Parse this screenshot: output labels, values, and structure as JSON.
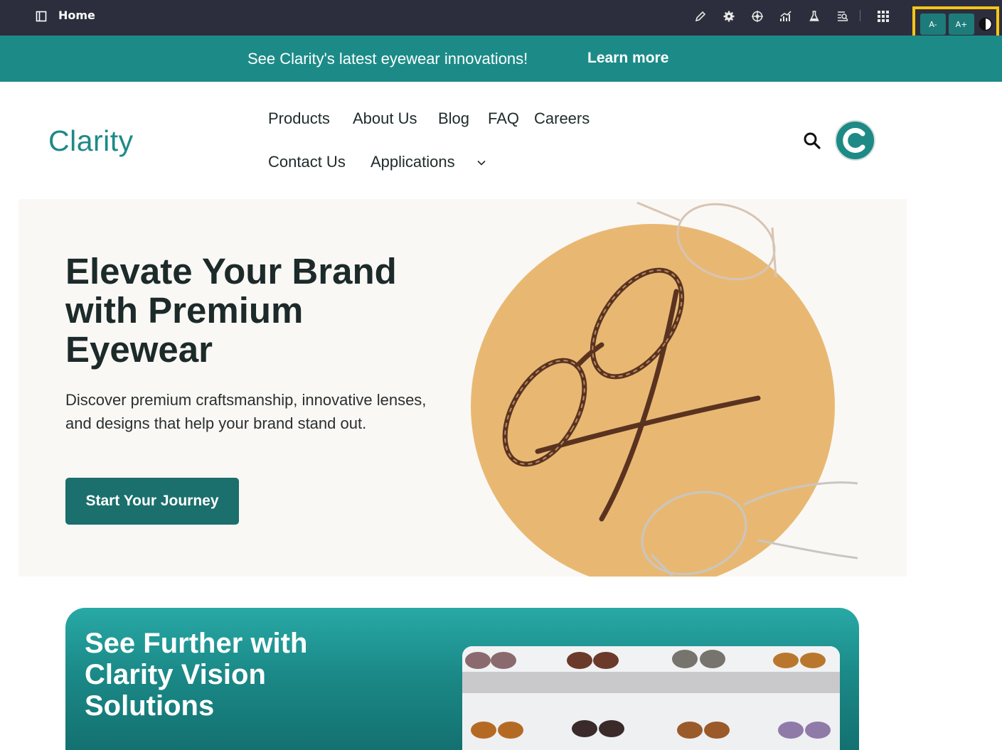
{
  "topbar": {
    "title": "Home",
    "tools": [
      "pencil-icon",
      "gear-icon",
      "target-icon",
      "chart-icon",
      "flask-icon",
      "inspect-icon"
    ],
    "apps_icon": "grid-icon"
  },
  "accessibility": {
    "decrease_label": "A-",
    "increase_label": "A+",
    "contrast_icon": "contrast-icon",
    "accent_color": "#1d7b7a",
    "highlight_color": "#f5c518"
  },
  "announcement": {
    "message": "See Clarity's latest eyewear innovations!",
    "link_label": "Learn more",
    "background": "#1c8b88"
  },
  "header": {
    "logo": "Clarity",
    "nav": {
      "row1": [
        "Products",
        "About Us",
        "Blog",
        "FAQ",
        "Careers"
      ],
      "row2": [
        "Contact Us",
        "Applications"
      ]
    },
    "avatar_initial": "C"
  },
  "hero": {
    "title": "Elevate Your Brand with Premium Eyewear",
    "description": "Discover premium craftsmanship, innovative lenses, and designs that help your brand stand out.",
    "cta_label": "Start Your Journey",
    "circle_color": "#e8b873"
  },
  "promo": {
    "title": "See Further with Clarity Vision Solutions"
  }
}
